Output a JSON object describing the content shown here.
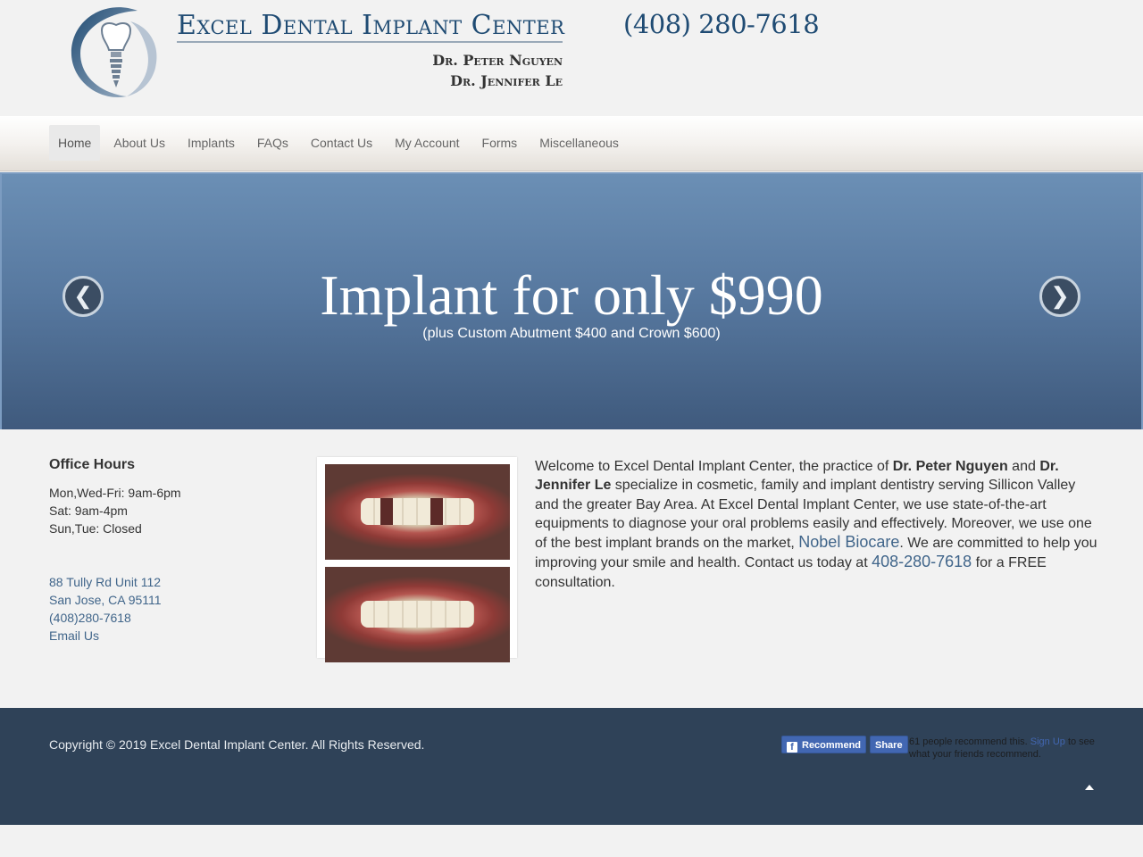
{
  "header": {
    "title": "Excel Dental Implant Center",
    "doctor_1": "Dr. Peter Nguyen",
    "doctor_2": "Dr. Jennifer Le",
    "phone": "(408) 280-7618"
  },
  "nav": {
    "items": [
      "Home",
      "About Us",
      "Implants",
      "FAQs",
      "Contact Us",
      "My Account",
      "Forms",
      "Miscellaneous"
    ],
    "active": "Home"
  },
  "hero": {
    "headline": "Implant for only $990",
    "subline": "(plus Custom Abutment $400 and Crown $600)",
    "prev_glyph": "❮",
    "next_glyph": "❯"
  },
  "office": {
    "title": "Office Hours",
    "hours": [
      "Mon,Wed-Fri: 9am-6pm",
      "Sat: 9am-4pm",
      "Sun,Tue: Closed"
    ],
    "address_1": "88 Tully Rd Unit 112",
    "address_2": "San Jose, CA 95111",
    "phone": "(408)280-7618",
    "email": "Email Us"
  },
  "intro": {
    "p1": "Welcome to Excel Dental Implant Center, the practice of ",
    "dr1": "Dr. Peter Nguyen",
    "p2": " and ",
    "dr2": "Dr. Jennifer Le",
    "p3": " specialize in cosmetic, family and implant dentistry serving Sillicon Valley and the greater Bay Area.  At Excel Dental Implant Center, we use state-of-the-art equipments to diagnose your oral problems easily and effectively. Moreover, we use one of the best implant brands on the market, ",
    "brand": "Nobel Biocare",
    "p4": ".  We are committed to help you improving your smile and health.  Contact us today at ",
    "phone": "408-280-7618",
    "p5": " for a FREE consultation."
  },
  "footer": {
    "copyright": "Copyright © 2019 Excel Dental Implant Center. All Rights Reserved.",
    "fb_recommend": "Recommend",
    "fb_share": "Share",
    "fb_count_text": "61 people recommend this. ",
    "fb_signup": "Sign Up",
    "fb_tail": " to see what your friends recommend."
  },
  "colors": {
    "brand_blue": "#1f4b73",
    "link_blue": "#40658a",
    "hero_blue": "#56779e",
    "footer_bg": "#2f4258",
    "facebook_blue": "#4267b2"
  },
  "icons": {
    "logo": "tooth-implant-logo-icon",
    "prev": "chevron-left-icon",
    "next": "chevron-right-icon",
    "facebook": "facebook-icon",
    "to_top": "arrow-up-icon"
  }
}
